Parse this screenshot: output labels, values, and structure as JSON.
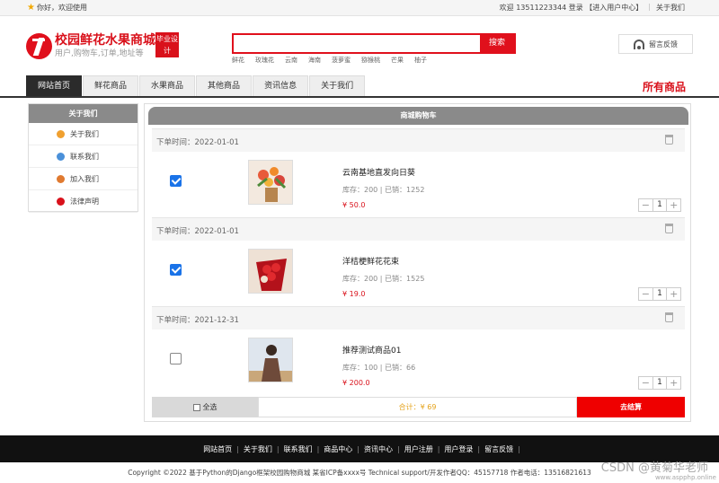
{
  "topbar": {
    "greeting": "你好，欢迎使用",
    "welcome": "欢迎 13511223344 登录 【进入用户中心】",
    "about": "关于我们"
  },
  "logo": {
    "title": "校园鲜花水果商城",
    "subtitle": "用户,购物车,订单,地址等",
    "badge": "毕业设计"
  },
  "search": {
    "value": "",
    "button": "搜索",
    "hotwords": [
      "鲜花",
      "玫瑰花",
      "云南",
      "海南",
      "菠萝蜜",
      "猕猴桃",
      "芒果",
      "柚子"
    ]
  },
  "feedback": "留言反馈",
  "nav": {
    "tabs": [
      "网站首页",
      "鲜花商品",
      "水果商品",
      "其他商品",
      "资讯信息",
      "关于我们"
    ],
    "all_goods": "所有商品"
  },
  "sidebar": {
    "title": "关于我们",
    "items": [
      {
        "label": "关于我们",
        "color": "#f0a030"
      },
      {
        "label": "联系我们",
        "color": "#4a90d9"
      },
      {
        "label": "加入我们",
        "color": "#e07a30"
      },
      {
        "label": "法律声明",
        "color": "#d9111b"
      }
    ]
  },
  "cart": {
    "title": "商城购物车",
    "orders": [
      {
        "time": "下单时间：2022-01-01",
        "checked": true,
        "name": "云南基地直发向日葵",
        "stock": "库存：200 | 已销：1252",
        "price": "¥ 50.0",
        "qty": "1"
      },
      {
        "time": "下单时间：2022-01-01",
        "checked": true,
        "name": "洋桔梗鲜花花束",
        "stock": "库存：200 | 已销：1525",
        "price": "¥ 19.0",
        "qty": "1"
      },
      {
        "time": "下单时间：2021-12-31",
        "checked": false,
        "name": "推荐测试商品01",
        "stock": "库存：100 | 已销：66",
        "price": "¥ 200.0",
        "qty": "1"
      }
    ],
    "select_all": "全选",
    "total": "合计：¥ 69",
    "checkout": "去结算"
  },
  "footer": {
    "links": [
      "网站首页",
      "关于我们",
      "联系我们",
      "商品中心",
      "资讯中心",
      "用户注册",
      "用户登录",
      "留言反馈"
    ],
    "copyright": "Copyright ©2022 基于Python的Django框架校园购物商城 某省ICP备xxxx号    Technical support/开发作者QQ：45157718    作者电话：13516821613"
  },
  "watermark": {
    "line1": "CSDN @黄菊华老师",
    "line2": "www.aspphp.online"
  }
}
